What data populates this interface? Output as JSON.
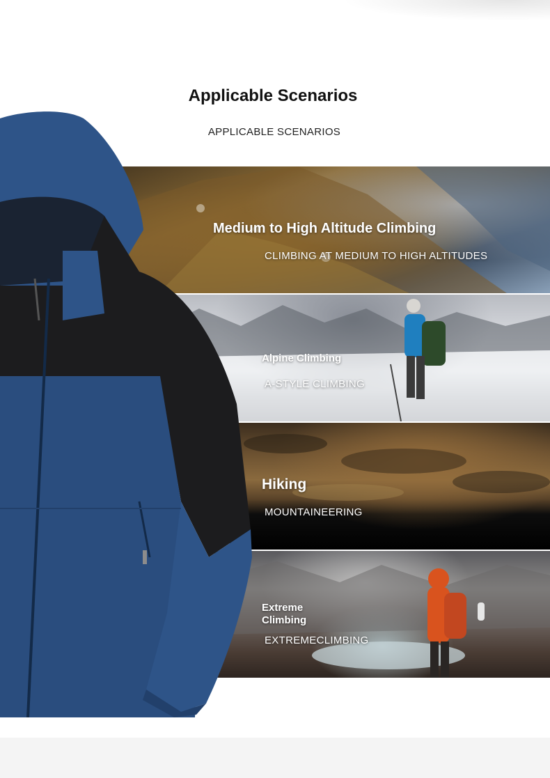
{
  "heading": {
    "title": "Applicable Scenarios",
    "subtitle": "APPLICABLE SCENARIOS"
  },
  "scenarios": [
    {
      "title": "Medium to High Altitude Climbing",
      "subtitle": "CLIMBING AT MEDIUM TO HIGH ALTITUDES"
    },
    {
      "title": "Alpine Climbing",
      "subtitle": "A-STYLE CLIMBING"
    },
    {
      "title": "Hiking",
      "subtitle": "MOUNTAINEERING"
    },
    {
      "title_line1": "Extreme",
      "title_line2": "Climbing",
      "subtitle": "EXTREMECLIMBING"
    }
  ],
  "colors": {
    "jacket_blue": "#2a4d7e",
    "jacket_black": "#1c1c1e",
    "hiker_jacket_orange": "#d9531e",
    "hiker_jacket_blue": "#1f7fbf"
  }
}
